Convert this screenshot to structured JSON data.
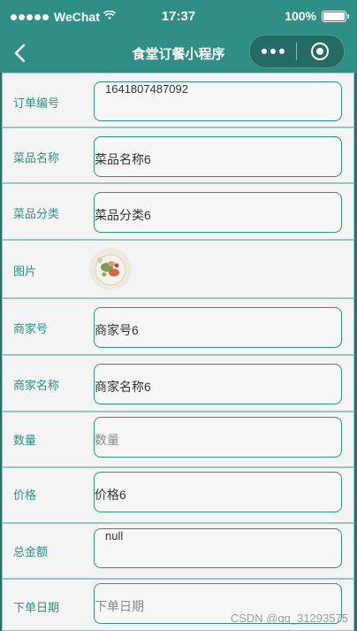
{
  "status_bar": {
    "carrier": "WeChat",
    "time": "17:37",
    "battery": "100%",
    "battery_level": 1.0
  },
  "nav": {
    "title": "食堂订餐小程序"
  },
  "form": {
    "order_no": {
      "label": "订单编号",
      "value": "1641807487092"
    },
    "dish_name": {
      "label": "菜品名称",
      "value": "菜品名称6"
    },
    "dish_category": {
      "label": "菜品分类",
      "value": "菜品分类6"
    },
    "image": {
      "label": "图片"
    },
    "merchant_no": {
      "label": "商家号",
      "value": "商家号6"
    },
    "merchant_name": {
      "label": "商家名称",
      "value": "商家名称6"
    },
    "quantity": {
      "label": "数量",
      "placeholder": "数量"
    },
    "price": {
      "label": "价格",
      "value": "价格6"
    },
    "total": {
      "label": "总金额",
      "value": "null"
    },
    "order_date": {
      "label": "下单日期",
      "placeholder": "下单日期"
    }
  },
  "watermark": "CSDN @qq_31293575",
  "colors": {
    "brand": "#2f8f86",
    "label": "#2f8f86",
    "row_bg": "#f4f4f4"
  }
}
